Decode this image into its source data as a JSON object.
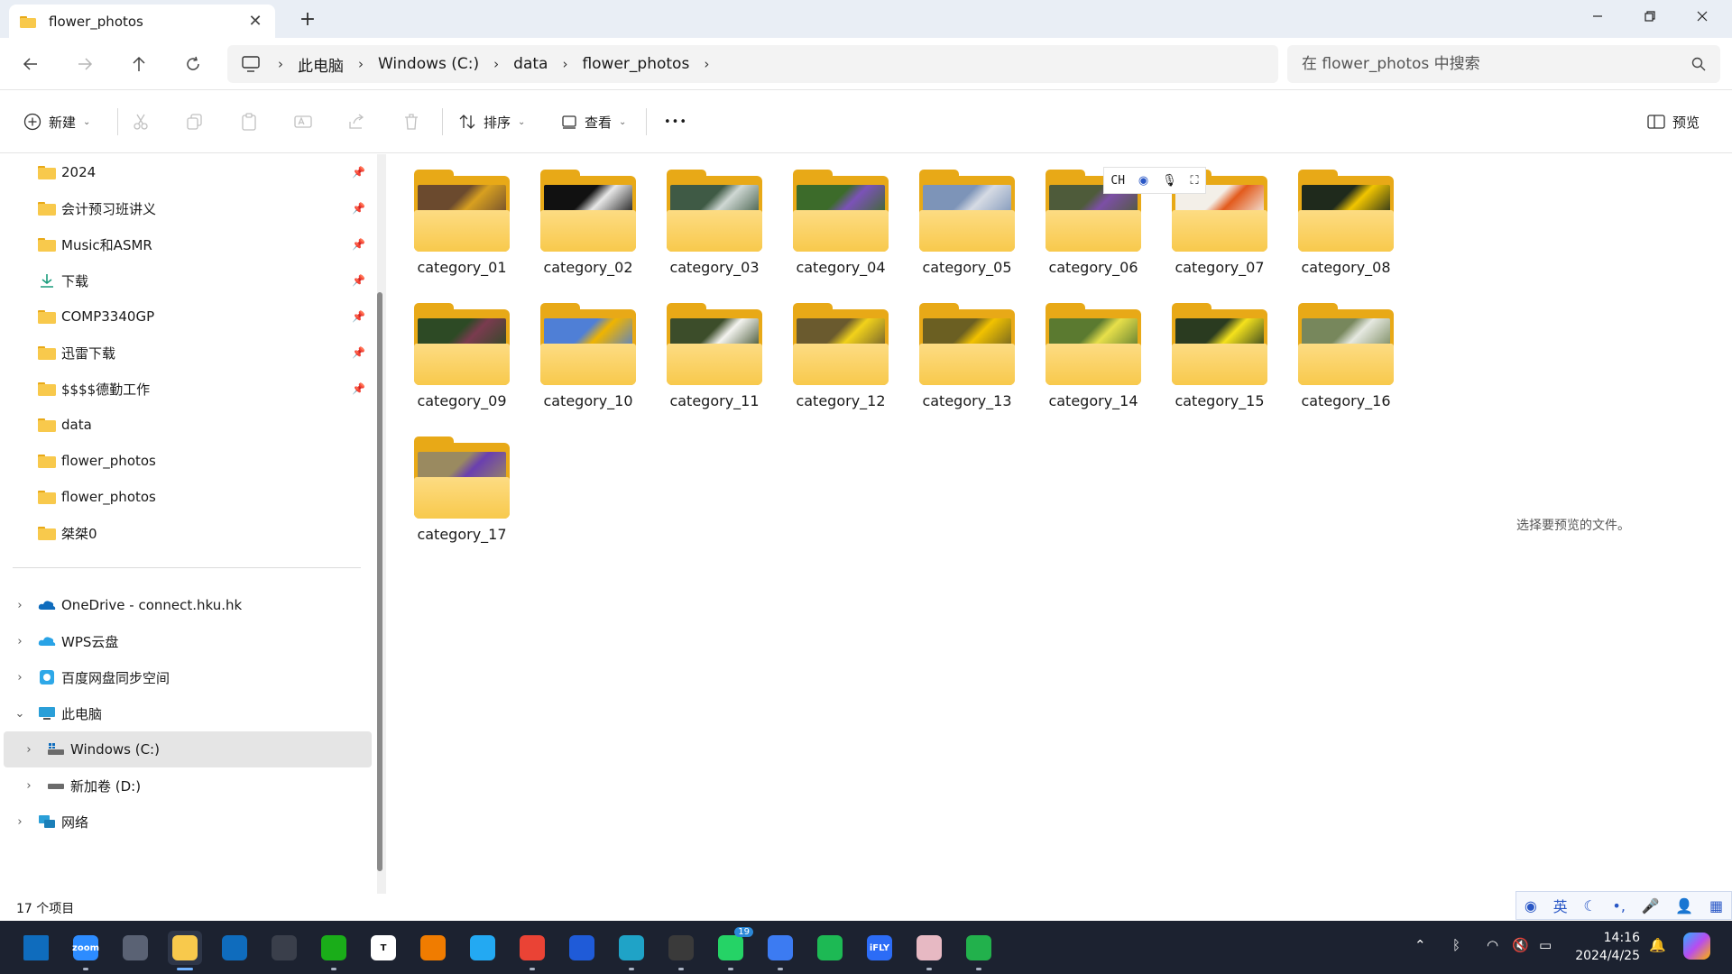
{
  "window": {
    "tab_title": "flower_photos",
    "new_tab_label": "+"
  },
  "address": {
    "crumbs": [
      "此电脑",
      "Windows (C:)",
      "data",
      "flower_photos"
    ],
    "search_placeholder": "在 flower_photos 中搜索"
  },
  "commands": {
    "new_label": "新建",
    "sort_label": "排序",
    "view_label": "查看",
    "more_label": "•••",
    "preview_label": "预览"
  },
  "sidebar": {
    "quick_access": [
      {
        "label": "2024",
        "pinned": true
      },
      {
        "label": "会计预习班讲义",
        "pinned": true
      },
      {
        "label": "Music和ASMR",
        "pinned": true
      },
      {
        "label": "下载",
        "pinned": true,
        "icon": "download-icon"
      },
      {
        "label": "COMP3340GP",
        "pinned": true
      },
      {
        "label": "迅雷下载",
        "pinned": true
      },
      {
        "label": "$$$$德勤工作",
        "pinned": true
      },
      {
        "label": "data",
        "pinned": false
      },
      {
        "label": "flower_photos",
        "pinned": false
      },
      {
        "label": "flower_photos",
        "pinned": false
      },
      {
        "label": "桀桀0",
        "pinned": false
      }
    ],
    "locations": [
      {
        "label": "OneDrive - connect.hku.hk",
        "icon": "onedrive-icon"
      },
      {
        "label": "WPS云盘",
        "icon": "wps-cloud-icon"
      },
      {
        "label": "百度网盘同步空间",
        "icon": "baidu-netdisk-icon"
      },
      {
        "label": "此电脑",
        "icon": "this-pc-icon",
        "expanded": true
      },
      {
        "label": "Windows (C:)",
        "icon": "drive-c-icon",
        "selected": true
      },
      {
        "label": "新加卷 (D:)",
        "icon": "drive-d-icon"
      },
      {
        "label": "网络",
        "icon": "network-icon"
      }
    ]
  },
  "folders": [
    {
      "name": "category_01",
      "photo": [
        "#6b4a2e",
        "#d8a020"
      ]
    },
    {
      "name": "category_02",
      "photo": [
        "#111111",
        "#e8e8e8"
      ]
    },
    {
      "name": "category_03",
      "photo": [
        "#3f5a45",
        "#cfd8d4"
      ]
    },
    {
      "name": "category_04",
      "photo": [
        "#3c6b2a",
        "#7b52b8"
      ]
    },
    {
      "name": "category_05",
      "photo": [
        "#7d94b8",
        "#d6dbe4"
      ]
    },
    {
      "name": "category_06",
      "photo": [
        "#4e5b3a",
        "#7c4fa6"
      ]
    },
    {
      "name": "category_07",
      "photo": [
        "#f3efe8",
        "#e35a1c"
      ]
    },
    {
      "name": "category_08",
      "photo": [
        "#1f2a1c",
        "#f1c500"
      ]
    },
    {
      "name": "category_09",
      "photo": [
        "#2d4a25",
        "#7a3b4f"
      ]
    },
    {
      "name": "category_10",
      "photo": [
        "#4f7fd6",
        "#f0b400"
      ]
    },
    {
      "name": "category_11",
      "photo": [
        "#3c4d2a",
        "#f4f4f0"
      ]
    },
    {
      "name": "category_12",
      "photo": [
        "#6a5a2e",
        "#f2d21a"
      ]
    },
    {
      "name": "category_13",
      "photo": [
        "#6b5f22",
        "#f2c200"
      ]
    },
    {
      "name": "category_14",
      "photo": [
        "#5b7a30",
        "#e8e04a"
      ]
    },
    {
      "name": "category_15",
      "photo": [
        "#2a3b20",
        "#f5e21c"
      ]
    },
    {
      "name": "category_16",
      "photo": [
        "#77875c",
        "#e6e9e1"
      ]
    },
    {
      "name": "category_17",
      "photo": [
        "#9a8a60",
        "#6a3fb0"
      ]
    }
  ],
  "preview_hint": "选择要预览的文件。",
  "status": {
    "item_count": "17 个项目"
  },
  "ime": {
    "float_label": "CH",
    "bar_label": "英"
  },
  "taskbar": {
    "apps": [
      {
        "name": "start-button",
        "label": ""
      },
      {
        "name": "zoom-app",
        "label": "zoom"
      },
      {
        "name": "settings-app",
        "label": ""
      },
      {
        "name": "file-explorer-app",
        "label": "",
        "active": true
      },
      {
        "name": "outlook-app",
        "label": ""
      },
      {
        "name": "obs-app",
        "label": ""
      },
      {
        "name": "wechat-app",
        "label": ""
      },
      {
        "name": "typora-app",
        "label": "T"
      },
      {
        "name": "search-app",
        "label": ""
      },
      {
        "name": "vscode-app",
        "label": ""
      },
      {
        "name": "chrome-app",
        "label": ""
      },
      {
        "name": "feishu-app",
        "label": ""
      },
      {
        "name": "edge-app",
        "label": ""
      },
      {
        "name": "terminal-app",
        "label": ""
      },
      {
        "name": "whatsapp-app",
        "label": "",
        "badge": "19"
      },
      {
        "name": "mail-bird-app",
        "label": ""
      },
      {
        "name": "loading-app",
        "label": ""
      },
      {
        "name": "ifly-app",
        "label": "iFLY"
      },
      {
        "name": "game-app",
        "label": ""
      },
      {
        "name": "green-app",
        "label": ""
      }
    ],
    "time": "14:16",
    "date": "2024/4/25"
  },
  "colors": {
    "folder_back": "#e8a917",
    "folder_front": "#fddc83",
    "taskbar_bg": "#1c2230",
    "selection_bg": "#e5e5e5"
  }
}
